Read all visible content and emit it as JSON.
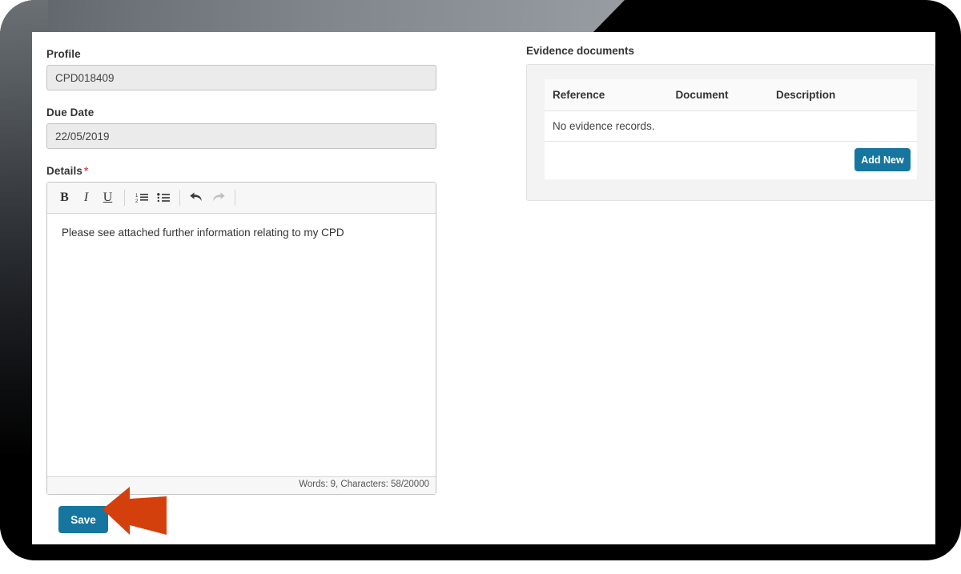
{
  "form": {
    "profile": {
      "label": "Profile",
      "value": "CPD018409"
    },
    "due_date": {
      "label": "Due Date",
      "value": "22/05/2019"
    },
    "details": {
      "label": "Details",
      "required_marker": "*",
      "content": "Please see attached further information relating to my CPD",
      "status": "Words: 9, Characters: 58/20000",
      "toolbar": [
        {
          "name": "bold-icon",
          "glyph": "B"
        },
        {
          "name": "italic-icon",
          "glyph": "I"
        },
        {
          "name": "underline-icon",
          "glyph": "U"
        },
        {
          "name": "ordered-list-icon",
          "glyph": ""
        },
        {
          "name": "unordered-list-icon",
          "glyph": ""
        },
        {
          "name": "undo-icon",
          "glyph": ""
        },
        {
          "name": "redo-icon",
          "glyph": ""
        }
      ]
    },
    "save_label": "Save"
  },
  "evidence": {
    "title": "Evidence documents",
    "columns": [
      "Reference",
      "Document",
      "Description"
    ],
    "empty_message": "No evidence records.",
    "add_new_label": "Add New"
  },
  "colors": {
    "primary_button": "#17769f",
    "callout_arrow": "#d4400c",
    "required_star": "#d9534f",
    "input_background": "#ebebeb",
    "panel_background": "#f3f3f3"
  }
}
